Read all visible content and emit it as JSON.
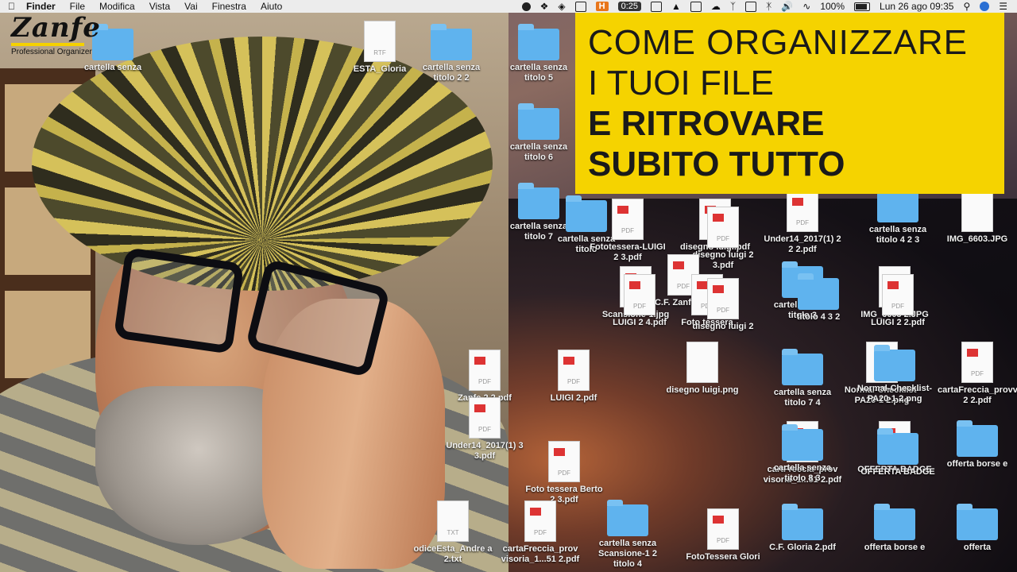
{
  "menubar": {
    "app": "Finder",
    "menus": [
      "File",
      "Modifica",
      "Vista",
      "Vai",
      "Finestra",
      "Aiuto"
    ],
    "timer": "0:25",
    "h_badge": "H",
    "battery": "100%",
    "datetime": "Lun 26 ago  09:35"
  },
  "logo": {
    "name": "Zanfe",
    "subtitle": "Professional Organizer"
  },
  "title_card": {
    "line1": "COME ORGANIZZARE",
    "line2": "I TUOI FILE",
    "line3": "E RITROVARE",
    "line4": "SUBITO TUTTO",
    "background": "#f5d300"
  },
  "desktop": {
    "items": [
      {
        "label": "cartella senza titolo 2 2",
        "type": "folder"
      },
      {
        "label": "cartella senza titolo 5",
        "type": "folder"
      },
      {
        "label": "cartella senza titolo 6",
        "type": "folder"
      },
      {
        "label": "cartella senza titolo 7",
        "type": "folder"
      },
      {
        "label": "cartella senza titolo",
        "type": "folder"
      },
      {
        "label": "Fototessera-LUIGI 2 3.pdf",
        "type": "pdf"
      },
      {
        "label": "disegno luigi.pdf",
        "type": "pdf"
      },
      {
        "label": "disegno luigi 2 3.pdf",
        "type": "pdf"
      },
      {
        "label": "C.F. Zanfe.pdf",
        "type": "pdf"
      },
      {
        "label": "Scansione-1.jpg",
        "type": "pdf"
      },
      {
        "label": "LUIGI 2 4.pdf",
        "type": "pdf"
      },
      {
        "label": "Foto tessera",
        "type": "pdf"
      },
      {
        "label": "disegno luigi 2",
        "type": "pdf"
      },
      {
        "label": "LUIGI 2.pdf",
        "type": "pdf"
      },
      {
        "label": "disegno luigi.png",
        "type": "doc"
      },
      {
        "label": "Zanfe 2 2.pdf",
        "type": "pdf"
      },
      {
        "label": "Under14_2017(1) 3 3.pdf",
        "type": "pdf"
      },
      {
        "label": "Foto tessera Berto 2 3.pdf",
        "type": "pdf"
      },
      {
        "label": "odiceEsta_Andre a 2.txt",
        "type": "txt"
      },
      {
        "label": "cartaFreccia_prov visoria_1...51 2.pdf",
        "type": "pdf"
      },
      {
        "label": "cartella senza Scansione-1 2 titolo 4",
        "type": "folder"
      },
      {
        "label": "FotoTessera Glori",
        "type": "pdf"
      },
      {
        "label": "C.F. Gloria 2.pdf",
        "type": "folder"
      },
      {
        "label": "offerta borse e",
        "type": "folder"
      },
      {
        "label": "offerta",
        "type": "folder"
      },
      {
        "label": "Under14_2017(1) 2 2 2.pdf",
        "type": "pdf"
      },
      {
        "label": "cartella senza titolo 4 2 3",
        "type": "folder"
      },
      {
        "label": "IMG_6603.JPG",
        "type": "doc"
      },
      {
        "label": "cartella senza titolo 3",
        "type": "folder"
      },
      {
        "label": "IMG_6603 2.JPG",
        "type": "doc"
      },
      {
        "label": "LUIGI 2 2.pdf",
        "type": "pdf"
      },
      {
        "label": "titolo 4 3 2",
        "type": "folder"
      },
      {
        "label": "Normal-Checklist-PA20-1 2.png",
        "type": "doc"
      },
      {
        "label": "cartaFreccia_provvisoria_1...51 2 2.pdf",
        "type": "pdf"
      },
      {
        "label": "cartella senza titolo 7 4",
        "type": "folder"
      },
      {
        "label": "Normal-Checklist-PA20-1 2.png",
        "type": "folder"
      },
      {
        "label": "OFFERTA BADGE",
        "type": "pdf"
      },
      {
        "label": "cartFreccia_prov visoria_1...51 2.pdf",
        "type": "pdf"
      },
      {
        "label": "cartella senza titolo 8 3",
        "type": "folder"
      },
      {
        "label": "OFFERTA BADGE",
        "type": "folder"
      },
      {
        "label": "offerta borse e",
        "type": "folder"
      },
      {
        "label": "ESTA_Gloria",
        "type": "rtf"
      },
      {
        "label": "cartella senza",
        "type": "folder"
      }
    ]
  }
}
